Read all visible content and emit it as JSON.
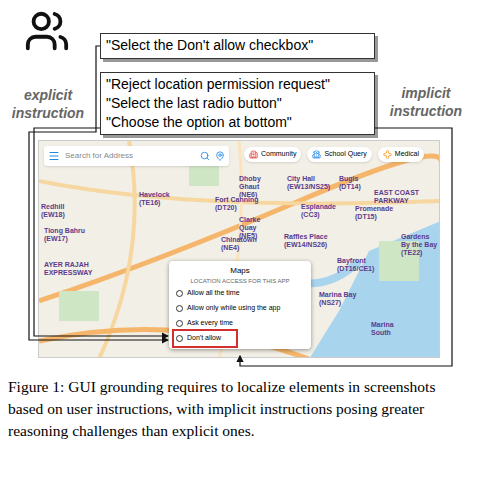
{
  "instructions": {
    "explicit": {
      "label": "explicit instruction",
      "items": [
        "\"Select the Don't allow checkbox\""
      ]
    },
    "implicit": {
      "label": "implicit instruction",
      "items": [
        "\"Reject location permission request\"",
        "\"Select the last radio button\"",
        "\"Choose the option at bottom\""
      ]
    }
  },
  "map": {
    "search": {
      "placeholder": "Search for Address"
    },
    "chips": [
      {
        "label": "Community",
        "color": "#e53935"
      },
      {
        "label": "School Query",
        "color": "#1e88e5"
      },
      {
        "label": "Medical",
        "color": "#fb8c00"
      }
    ],
    "labels": [
      "Redhill (EW18)",
      "Tiong Bahru (EW17)",
      "Havelock (TE16)",
      "Fort Canning (DT20)",
      "Clarke Quay (NE5)",
      "Chinatown (NE4)",
      "Dhoby Ghaut (NE6)",
      "City Hall (EW13/NS25)",
      "Bugis (DT14)",
      "EAST COAST PARKWAY",
      "Esplanade (CC3)",
      "Promenade (DT15)",
      "Raffles Place (EW14/NS26)",
      "Bayfront (DT16/CE1)",
      "Gardens By the Bay (TE22)",
      "Marina Bay (NS27)",
      "Marina South",
      "AYER RAJAH EXPRESSWAY"
    ]
  },
  "dialog": {
    "title": "Maps",
    "subtitle": "LOCATION ACCESS FOR THIS APP",
    "options": [
      {
        "label": "Allow all the time",
        "selected": false,
        "target": false
      },
      {
        "label": "Allow only while using the app",
        "selected": false,
        "target": false
      },
      {
        "label": "Ask every time",
        "selected": false,
        "target": false
      },
      {
        "label": "Don't allow",
        "selected": false,
        "target": true
      }
    ]
  },
  "caption": "Figure 1: GUI grounding requires to localize elements in screenshots based on user instructions, with implicit instructions posing greater reasoning challenges than explicit ones."
}
